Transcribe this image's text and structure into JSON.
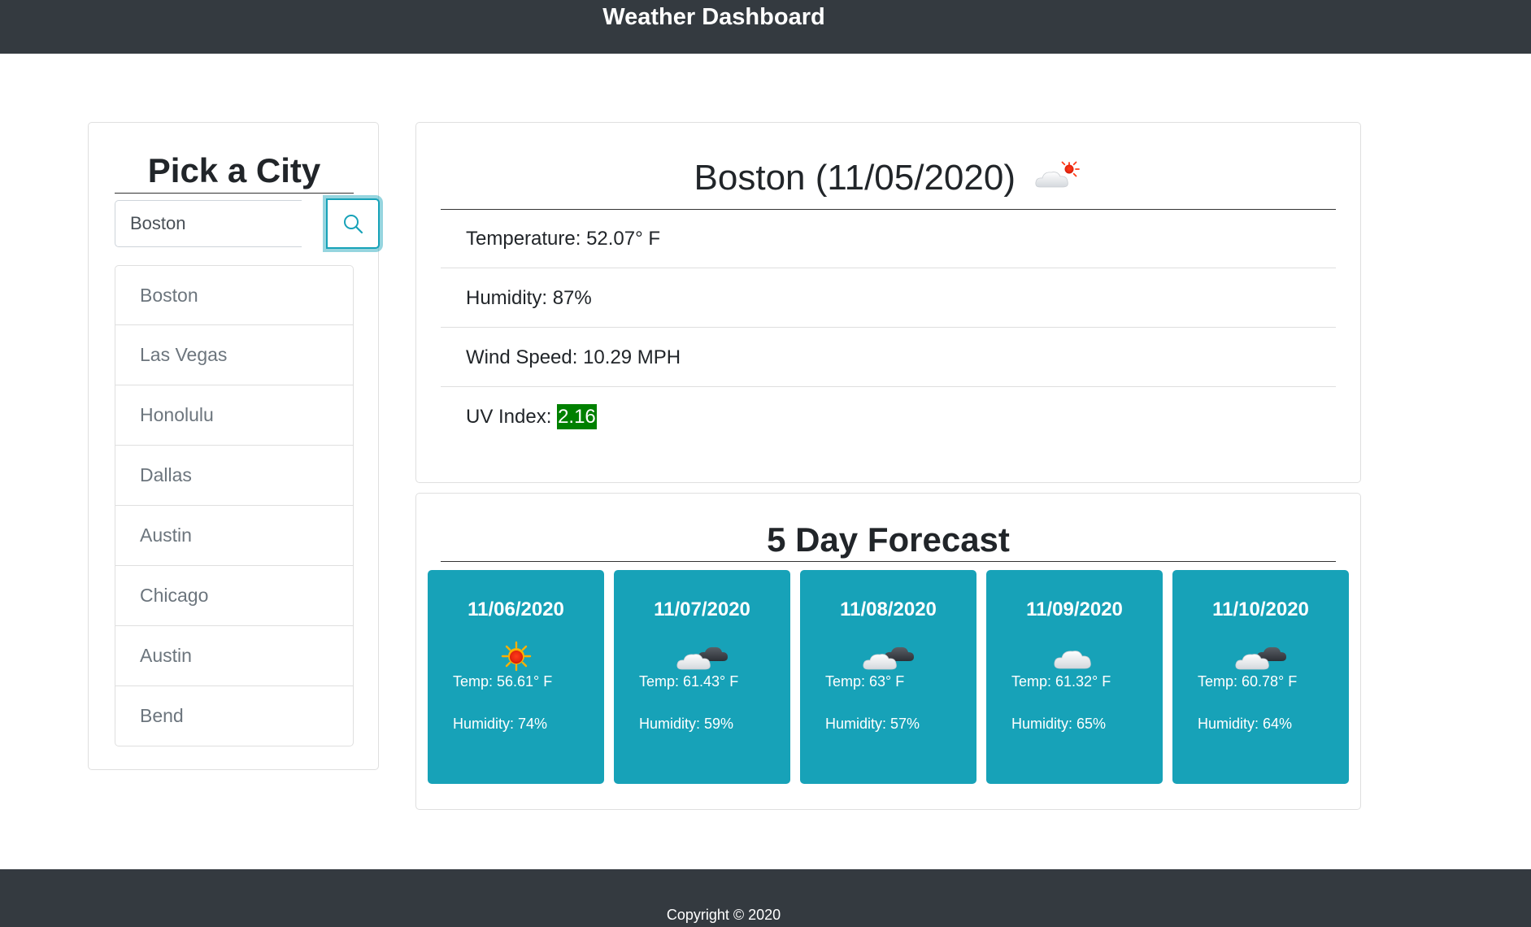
{
  "header": {
    "title": "Weather Dashboard"
  },
  "sidebar": {
    "heading": "Pick a City",
    "search": {
      "value": "Boston",
      "icon": "search-icon"
    },
    "cities": [
      "Boston",
      "Las Vegas",
      "Honolulu",
      "Dallas",
      "Austin",
      "Chicago",
      "Austin",
      "Bend"
    ]
  },
  "current": {
    "title": "Boston (11/05/2020)",
    "icon": "partly-cloudy-sun-icon",
    "temperature": "Temperature: 52.07° F",
    "humidity": "Humidity: 87%",
    "wind": "Wind Speed: 10.29 MPH",
    "uv_label": "UV Index: ",
    "uv_value": "2.16",
    "uv_color": "#008000"
  },
  "forecast": {
    "heading": "5 Day Forecast",
    "card_color": "#17a2b8",
    "days": [
      {
        "date": "11/06/2020",
        "icon": "sun-icon",
        "temp": "Temp: 56.61° F",
        "humidity": "Humidity: 74%"
      },
      {
        "date": "11/07/2020",
        "icon": "dark-clouds-icon",
        "temp": "Temp: 61.43° F",
        "humidity": "Humidity: 59%"
      },
      {
        "date": "11/08/2020",
        "icon": "dark-clouds-icon",
        "temp": "Temp: 63° F",
        "humidity": "Humidity: 57%"
      },
      {
        "date": "11/09/2020",
        "icon": "cloud-icon",
        "temp": "Temp: 61.32° F",
        "humidity": "Humidity: 65%"
      },
      {
        "date": "11/10/2020",
        "icon": "dark-clouds-icon",
        "temp": "Temp: 60.78° F",
        "humidity": "Humidity: 64%"
      }
    ]
  },
  "footer": {
    "copyright": "Copyright © 2020"
  }
}
